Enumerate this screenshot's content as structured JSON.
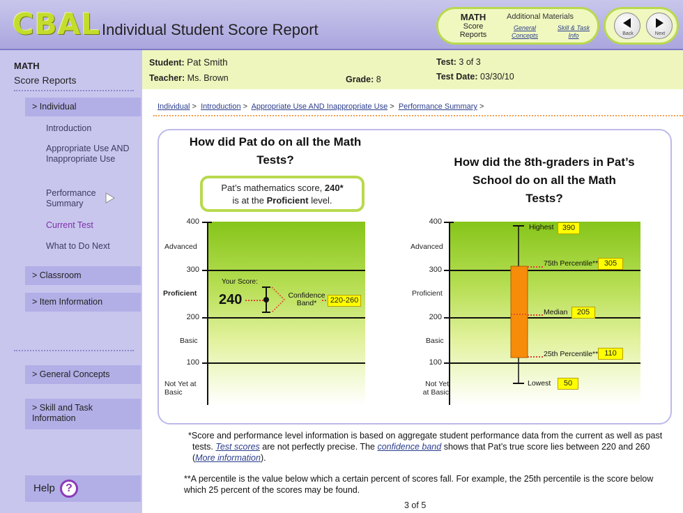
{
  "header": {
    "logo": "CBAL",
    "title": "Individual Student Score Report",
    "math_label": "MATH",
    "score_reports_label": "Score Reports",
    "additional_materials": "Additional Materials",
    "general_concepts_link": "General Concepts",
    "skill_task_link": "Skill & Task Info",
    "back_label": "Back",
    "next_label": "Next"
  },
  "sidebar": {
    "title_line1": "MATH",
    "title_line2": "Score Reports",
    "individual": "> Individual",
    "sub_items": [
      "Introduction",
      "Appropriate Use AND Inappropriate Use",
      "Performance Summary",
      "Current Test",
      "What to Do Next"
    ],
    "classroom": "> Classroom",
    "item_information": "> Item Information",
    "general_concepts": "> General Concepts",
    "skill_task": "> Skill and Task Information",
    "help": "Help"
  },
  "info": {
    "student_label": "Student:",
    "student": "Pat Smith",
    "teacher_label": "Teacher:",
    "teacher": "Ms. Brown",
    "grade_label": "Grade:",
    "grade": "8",
    "test_label": "Test:",
    "test": "3 of 3",
    "date_label": "Test Date:",
    "date": "03/30/10"
  },
  "breadcrumb": [
    "Individual",
    "Introduction",
    "Appropriate Use AND Inappropriate Use",
    "Performance Summary"
  ],
  "left_chart": {
    "question": "How did Pat do on all the Math Tests?",
    "callout_pre": "Pat’s mathematics score,",
    "callout_score": "240*",
    "callout_mid": "is at the",
    "callout_level": "Proficient",
    "callout_post": "level.",
    "y_ticks": [
      "400",
      "300",
      "200",
      "100"
    ],
    "levels": [
      "Advanced",
      "Proficient",
      "Basic",
      "Not Yet at Basic"
    ],
    "your_score_label": "Your Score:",
    "score": "240",
    "confidence_label": "Confidence Band*",
    "band": "220-260"
  },
  "right_chart": {
    "question": "How did the 8th-graders in Pat’s School do on all the Math Tests?",
    "y_ticks": [
      "400",
      "300",
      "200",
      "100"
    ],
    "levels": [
      "Advanced",
      "Proficient",
      "Basic",
      "Not Yet at Basic"
    ],
    "highest_label": "Highest",
    "highest": "390",
    "p75_label": "75th Percentile**",
    "p75": "305",
    "median_label": "Median",
    "median": "205",
    "p25_label": "25th Percentile**",
    "p25": "110",
    "lowest_label": "Lowest",
    "lowest": "50",
    "box_color": "#f78c0a"
  },
  "footnotes": {
    "fn1_a": "*Score and performance level information is based on aggregate student performance data from the current as well as past  tests.",
    "fn1_link1": "Test scores",
    "fn1_b": "are not perfectly precise. The",
    "fn1_link2": "confidence band",
    "fn1_c": "shows that Pat’s true score lies between 220 and 260 (",
    "fn1_link3": "More information",
    "fn1_d": ").",
    "fn2": "**A percentile is the value below which a certain percent of scores fall. For example, the 25th percentile is the score below which 25 percent of the scores may be found."
  },
  "page_number": "3 of 5"
}
